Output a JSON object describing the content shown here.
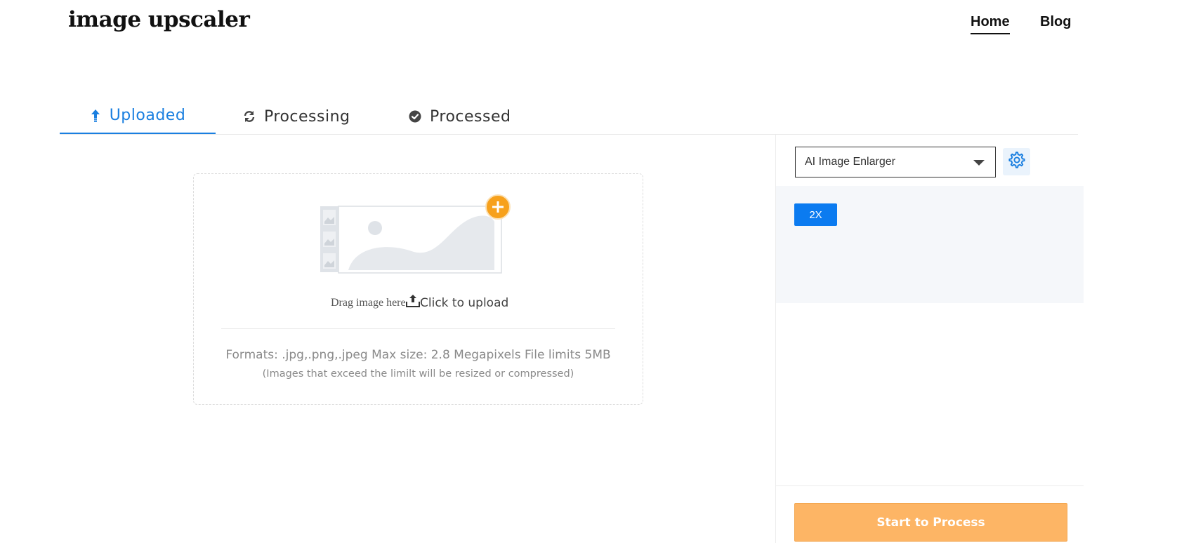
{
  "header": {
    "logo": "image upscaler",
    "nav": [
      {
        "label": "Home",
        "active": true
      },
      {
        "label": "Blog",
        "active": false
      }
    ]
  },
  "tabs": [
    {
      "label": "Uploaded",
      "icon": "upload-arrow-icon",
      "active": true
    },
    {
      "label": "Processing",
      "icon": "refresh-icon",
      "active": false
    },
    {
      "label": "Processed",
      "icon": "check-circle-icon",
      "active": false
    }
  ],
  "upload": {
    "drag_text": "Drag image here",
    "click_text": "Click to upload",
    "formats": "Formats: .jpg,.png,.jpeg Max size: 2.8 Megapixels File limits 5MB",
    "limit_note": "(Images that exceed the limilt will be resized or compressed)"
  },
  "sidebar": {
    "model_select": "AI Image Enlarger",
    "scale_option": "2X",
    "start_button": "Start to Process"
  },
  "colors": {
    "accent_blue": "#1a7fe0",
    "scale_blue": "#0b7bf0",
    "start_orange": "#fdb565",
    "plus_orange": "#f7a11c",
    "panel_bg": "#f5f7fa"
  }
}
